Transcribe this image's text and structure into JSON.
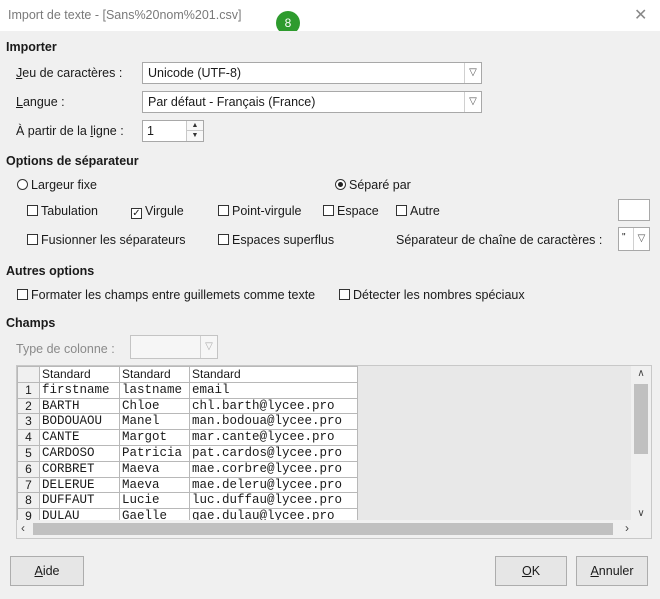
{
  "window": {
    "title": "Import de texte - [Sans%20nom%201.csv]",
    "badge": "8",
    "close_glyph": "✕"
  },
  "import": {
    "heading": "Importer",
    "charset_label": "Jeu de caractères :",
    "charset_value": "Unicode (UTF-8)",
    "language_label": "Langue :",
    "language_value": "Par défaut - Français (France)",
    "from_row_label": "À partir de la ligne :",
    "from_row_value": "1"
  },
  "separator_options": {
    "heading": "Options de séparateur",
    "fixed_width": "Largeur fixe",
    "separated_by": "Séparé par",
    "tab": "Tabulation",
    "comma": "Virgule",
    "semicolon": "Point-virgule",
    "space": "Espace",
    "other": "Autre",
    "merge": "Fusionner les séparateurs",
    "trim_spaces": "Espaces superflus",
    "string_delim_label": "Séparateur de chaîne de caractères :",
    "string_delim_value": "\"",
    "comma_checked": true,
    "separated_selected": true
  },
  "other_options": {
    "heading": "Autres options",
    "quoted_as_text": "Formater les champs entre guillemets comme texte",
    "detect_special": "Détecter les nombres spéciaux"
  },
  "fields": {
    "heading": "Champs",
    "column_type_label": "Type de colonne :",
    "column_headers": [
      "Standard",
      "Standard",
      "Standard"
    ],
    "rows": [
      {
        "n": "1",
        "c": [
          "firstname",
          "lastname",
          "email"
        ]
      },
      {
        "n": "2",
        "c": [
          "BARTH",
          "Chloe",
          "chl.barth@lycee.pro"
        ]
      },
      {
        "n": "3",
        "c": [
          "BODOUAOU",
          "Manel",
          "man.bodoua@lycee.pro"
        ]
      },
      {
        "n": "4",
        "c": [
          "CANTE",
          "Margot",
          "mar.cante@lycee.pro"
        ]
      },
      {
        "n": "5",
        "c": [
          "CARDOSO",
          "Patricia",
          "pat.cardos@lycee.pro"
        ]
      },
      {
        "n": "6",
        "c": [
          "CORBRET",
          "Maeva",
          "mae.corbre@lycee.pro"
        ]
      },
      {
        "n": "7",
        "c": [
          "DELERUE",
          "Maeva",
          "mae.deleru@lycee.pro"
        ]
      },
      {
        "n": "8",
        "c": [
          "DUFFAUT",
          "Lucie",
          "luc.duffau@lycee.pro"
        ]
      },
      {
        "n": "9",
        "c": [
          "DULAU",
          "Gaelle",
          "gae.dulau@lycee.pro"
        ]
      }
    ]
  },
  "buttons": {
    "help": "Aide",
    "ok": "OK",
    "cancel": "Annuler"
  },
  "colors": {
    "badge": "#2e9b2e",
    "dialog_bg": "#f0f0f0"
  }
}
